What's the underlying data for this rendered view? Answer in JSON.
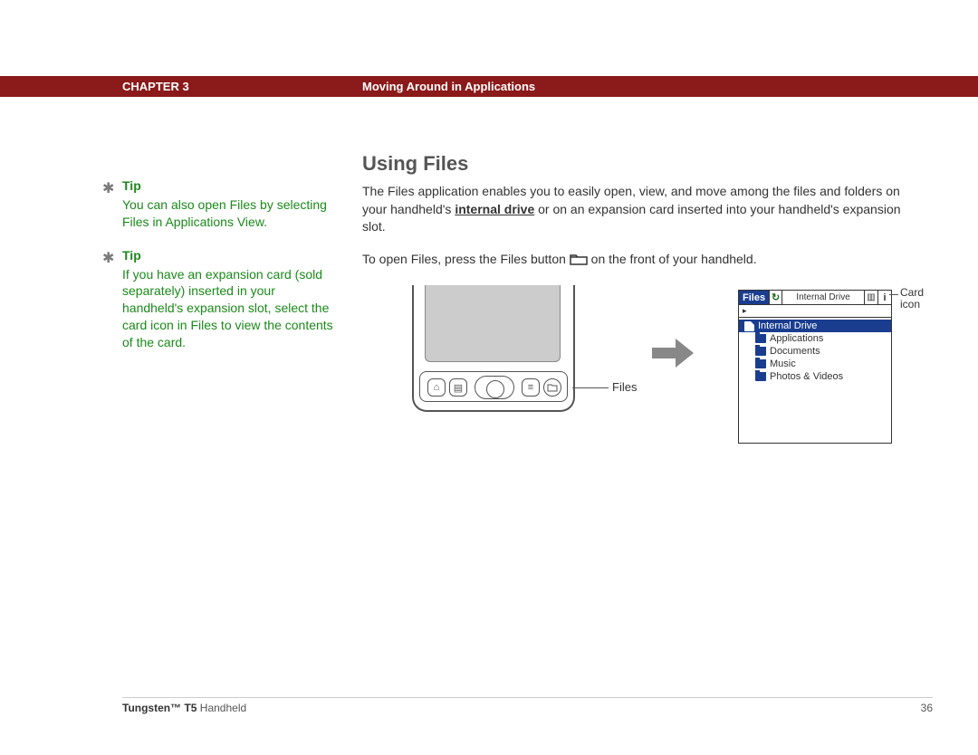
{
  "header": {
    "chapter": "CHAPTER 3",
    "title": "Moving Around in Applications"
  },
  "sidebar": {
    "tips": [
      {
        "label": "Tip",
        "body": "You can also open Files by selecting Files in Applications View."
      },
      {
        "label": "Tip",
        "body": "If you have an expansion card (sold separately) inserted in your handheld's expansion slot, select the card icon in Files to view the contents of the card."
      }
    ]
  },
  "main": {
    "title": "Using Files",
    "p1a": "The Files application enables you to easily open, view, and move among the files and folders on your handheld's ",
    "p1_link": "internal drive",
    "p1b": " or on an expansion card inserted into your handheld's expansion slot.",
    "p2a": "To open Files, press the Files button ",
    "p2b": " on the front of your handheld."
  },
  "figure": {
    "files_leader": "Files",
    "card_leader": "Card icon",
    "window": {
      "title": "Files",
      "drive": "Internal Drive",
      "path": "Internal Drive",
      "items": [
        "Applications",
        "Documents",
        "Music",
        "Photos & Videos"
      ]
    }
  },
  "footer": {
    "product_bold": "Tungsten™ T5",
    "product_rest": " Handheld",
    "page": "36"
  }
}
